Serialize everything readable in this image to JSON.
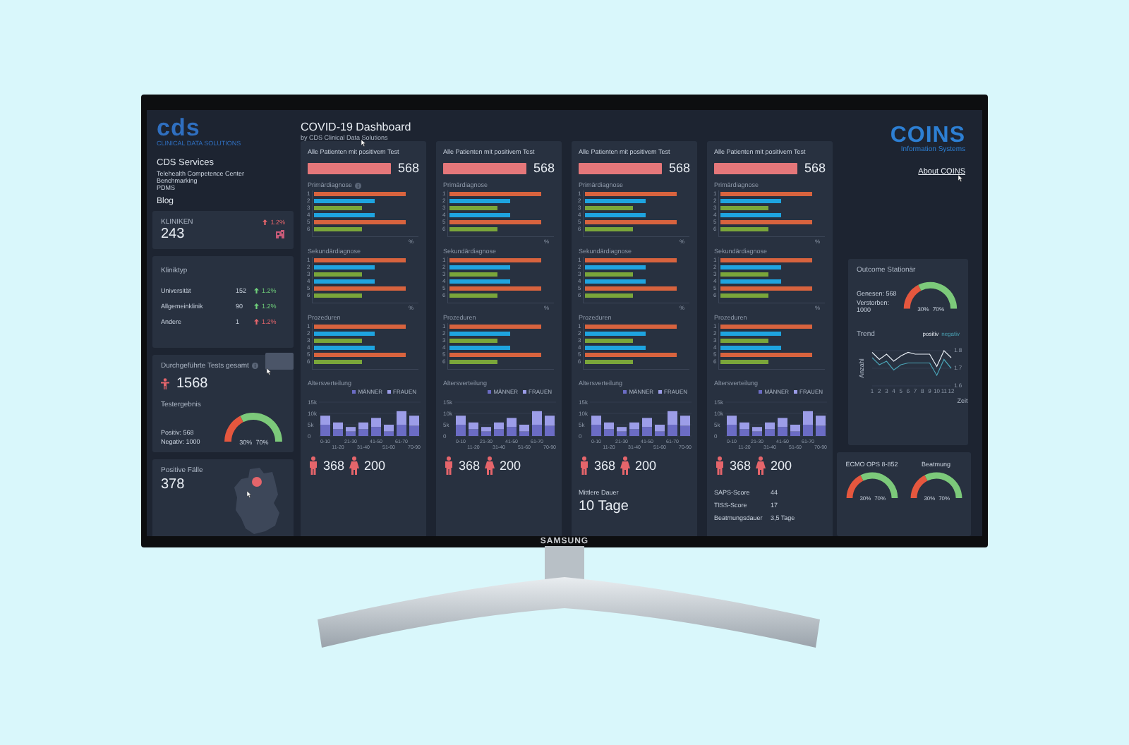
{
  "header": {
    "title": "COVID-19 Dashboard",
    "subtitle": "by CDS Clinical Data Solutions"
  },
  "brand": {
    "logo_text": "cds",
    "tagline": "CLINICAL DATA SOLUTIONS"
  },
  "nav": {
    "title": "CDS Services",
    "links": [
      "Telehealth Competence Center",
      "Benchmarking",
      "PDMS"
    ],
    "blog": "Blog"
  },
  "kliniken": {
    "label": "KLINIKEN",
    "change": "1.2%",
    "value": "243"
  },
  "kliniktyp": {
    "title": "Kliniktyp",
    "rows": [
      {
        "name": "Universität",
        "count": "152",
        "change": "1.2%",
        "color": "#6fcf7a"
      },
      {
        "name": "Allgemeinklinik",
        "count": "90",
        "change": "1.2%",
        "color": "#6fcf7a"
      },
      {
        "name": "Andere",
        "count": "1",
        "change": "1.2%",
        "color": "#e5656b"
      }
    ]
  },
  "tests": {
    "title": "Durchgeführte Tests gesamt",
    "value": "1568",
    "result_title": "Testergebnis",
    "positive": "Positiv: 568",
    "negative": "Negativ: 1000",
    "gauge": {
      "low": "30%",
      "high": "70%"
    }
  },
  "positive_cases": {
    "title": "Positive Fälle",
    "value": "378"
  },
  "panels": [
    {
      "title": "Alle Patienten mit positivem Test",
      "total": "568",
      "sections": [
        {
          "title": "Primärdiagnose",
          "info": true,
          "rows": [
            "1",
            "2",
            "3",
            "4",
            "5",
            "6"
          ],
          "unit": "%"
        },
        {
          "title": "Sekundärdiagnose",
          "info": false,
          "rows": [
            "1",
            "2",
            "3",
            "4",
            "5",
            "6"
          ],
          "unit": "%"
        },
        {
          "title": "Prozeduren",
          "info": false,
          "rows": [
            "1",
            "2",
            "3",
            "4",
            "5",
            "6"
          ]
        }
      ],
      "age": {
        "title": "Altersverteilung",
        "chart_data": {
          "type": "bar",
          "stacked": true,
          "categories": [
            "0-10",
            "11-20",
            "21-30",
            "31-40",
            "41-50",
            "51-60",
            "61-70",
            "70-90"
          ],
          "ylim": [
            0,
            15000
          ],
          "yticks": [
            {
              "value": 0,
              "label": "0"
            },
            {
              "value": 5000,
              "label": "5k"
            },
            {
              "value": 10000,
              "label": "10k"
            },
            {
              "value": 15000,
              "label": "15k"
            }
          ],
          "series": [
            {
              "name": "MÄNNER",
              "color": "#6b6cc4",
              "values": [
                5000,
                3000,
                2000,
                3000,
                4000,
                2000,
                5000,
                4500
              ]
            },
            {
              "name": "FRAUEN",
              "color": "#9c9de8",
              "values": [
                4000,
                3000,
                2000,
                3000,
                4000,
                3000,
                6000,
                4500
              ]
            }
          ]
        }
      },
      "male": "368",
      "female": "200"
    },
    {
      "title": "Alle Patienten mit positivem Test",
      "total": "568",
      "sections": [
        {
          "title": "Primärdiagnose",
          "info": false,
          "rows": [
            "1",
            "2",
            "3",
            "4",
            "5",
            "6"
          ],
          "unit": "%"
        },
        {
          "title": "Sekundärdiagnose",
          "info": false,
          "rows": [
            "1",
            "2",
            "3",
            "4",
            "5",
            "6"
          ],
          "unit": "%"
        },
        {
          "title": "Prozeduren",
          "info": false,
          "rows": [
            "1",
            "2",
            "3",
            "4",
            "5",
            "6"
          ]
        }
      ],
      "age": {
        "title": "Altersverteilung",
        "chart_data": {
          "type": "bar",
          "stacked": true,
          "categories": [
            "0-10",
            "11-20",
            "21-30",
            "31-40",
            "41-50",
            "51-60",
            "61-70",
            "70-90"
          ],
          "ylim": [
            0,
            15000
          ],
          "yticks": [
            {
              "value": 0,
              "label": "0"
            },
            {
              "value": 5000,
              "label": "5k"
            },
            {
              "value": 10000,
              "label": "10k"
            },
            {
              "value": 15000,
              "label": "15k"
            }
          ],
          "series": [
            {
              "name": "MÄNNER",
              "color": "#6b6cc4",
              "values": [
                5000,
                3000,
                2000,
                3000,
                4000,
                2000,
                5000,
                4500
              ]
            },
            {
              "name": "FRAUEN",
              "color": "#9c9de8",
              "values": [
                4000,
                3000,
                2000,
                3000,
                4000,
                3000,
                6000,
                4500
              ]
            }
          ]
        }
      },
      "male": "368",
      "female": "200"
    },
    {
      "title": "Alle Patienten mit positivem Test",
      "total": "568",
      "sections": [
        {
          "title": "Primärdiagnose",
          "info": false,
          "rows": [
            "1",
            "2",
            "3",
            "4",
            "5",
            "6"
          ],
          "unit": "%"
        },
        {
          "title": "Sekundärdiagnose",
          "info": false,
          "rows": [
            "1",
            "2",
            "3",
            "4",
            "5",
            "6"
          ],
          "unit": "%"
        },
        {
          "title": "Prozeduren",
          "info": false,
          "rows": [
            "1",
            "2",
            "3",
            "4",
            "5",
            "6"
          ]
        }
      ],
      "age": {
        "title": "Altersverteilung",
        "chart_data": {
          "type": "bar",
          "stacked": true,
          "categories": [
            "0-10",
            "11-20",
            "21-30",
            "31-40",
            "41-50",
            "51-60",
            "61-70",
            "70-90"
          ],
          "ylim": [
            0,
            15000
          ],
          "yticks": [
            {
              "value": 0,
              "label": "0"
            },
            {
              "value": 5000,
              "label": "5k"
            },
            {
              "value": 10000,
              "label": "10k"
            },
            {
              "value": 15000,
              "label": "15k"
            }
          ],
          "series": [
            {
              "name": "MÄNNER",
              "color": "#6b6cc4",
              "values": [
                5000,
                3000,
                2000,
                3000,
                4000,
                2000,
                5000,
                4500
              ]
            },
            {
              "name": "FRAUEN",
              "color": "#9c9de8",
              "values": [
                4000,
                3000,
                2000,
                3000,
                4000,
                3000,
                6000,
                4500
              ]
            }
          ]
        }
      },
      "male": "368",
      "female": "200",
      "extra": {
        "kind": "duration",
        "label": "Mittlere Dauer",
        "value": "10 Tage"
      }
    },
    {
      "title": "Alle Patienten mit positivem Test",
      "total": "568",
      "sections": [
        {
          "title": "Primärdiagnose",
          "info": false,
          "rows": [
            "1",
            "2",
            "3",
            "4",
            "5",
            "6"
          ],
          "unit": "%"
        },
        {
          "title": "Sekundärdiagnose",
          "info": false,
          "rows": [
            "1",
            "2",
            "3",
            "4",
            "5",
            "6"
          ],
          "unit": "%"
        },
        {
          "title": "Prozeduren",
          "info": false,
          "rows": [
            "1",
            "2",
            "3",
            "4",
            "5",
            "6"
          ]
        }
      ],
      "age": {
        "title": "Altersverteilung",
        "chart_data": {
          "type": "bar",
          "stacked": true,
          "categories": [
            "0-10",
            "11-20",
            "21-30",
            "31-40",
            "41-50",
            "51-60",
            "61-70",
            "70-90"
          ],
          "ylim": [
            0,
            15000
          ],
          "yticks": [
            {
              "value": 0,
              "label": "0"
            },
            {
              "value": 5000,
              "label": "5k"
            },
            {
              "value": 10000,
              "label": "10k"
            },
            {
              "value": 15000,
              "label": "15k"
            }
          ],
          "series": [
            {
              "name": "MÄNNER",
              "color": "#6b6cc4",
              "values": [
                5000,
                3000,
                2000,
                3000,
                4000,
                2000,
                5000,
                4500
              ]
            },
            {
              "name": "FRAUEN",
              "color": "#9c9de8",
              "values": [
                4000,
                3000,
                2000,
                3000,
                4000,
                3000,
                6000,
                4500
              ]
            }
          ]
        }
      },
      "male": "368",
      "female": "200",
      "extra": {
        "kind": "scores",
        "rows": [
          {
            "label": "SAPS-Score",
            "value": "44"
          },
          {
            "label": "TISS-Score",
            "value": "17"
          },
          {
            "label": "Beatmungsdauer",
            "value": "3,5 Tage"
          }
        ]
      }
    }
  ],
  "coins": {
    "logo_text": "COINS",
    "tagline": "Information Systems",
    "link": "About COINS"
  },
  "outcome": {
    "title": "Outcome Stationär",
    "recovered": "Genesen: 568",
    "deceased": "Verstorben: 1000",
    "gauge": {
      "low": "30%",
      "high": "70%"
    },
    "trend": {
      "title": "Trend",
      "chart_data": {
        "type": "line",
        "grid": true,
        "xlabel": "Zeit",
        "ylabel": "Anzahl",
        "x": [
          1,
          2,
          3,
          4,
          5,
          6,
          7,
          8,
          9,
          10,
          11,
          12
        ],
        "xlim": [
          1,
          12
        ],
        "xticks": [
          1,
          2,
          3,
          4,
          5,
          6,
          7,
          8,
          9,
          10,
          11,
          12
        ],
        "ylim": [
          1.6,
          1.8
        ],
        "yticks": [
          1.6,
          1.7,
          1.8
        ],
        "series": [
          {
            "name": "positiv",
            "color": "#e8eef5",
            "values": [
              1.79,
              1.75,
              1.78,
              1.74,
              1.77,
              1.79,
              1.78,
              1.78,
              1.78,
              1.71,
              1.8,
              1.76
            ]
          },
          {
            "name": "negativ",
            "color": "#4aa3b5",
            "values": [
              1.76,
              1.72,
              1.74,
              1.69,
              1.72,
              1.73,
              1.73,
              1.73,
              1.73,
              1.66,
              1.75,
              1.7
            ]
          }
        ]
      }
    }
  },
  "ventilation": {
    "gauges": [
      {
        "title": "ECMO OPS 8-852",
        "low": "30%",
        "high": "70%"
      },
      {
        "title": "Beatmung",
        "low": "30%",
        "high": "70%"
      }
    ]
  },
  "tv": {
    "brand": "SAMSUNG"
  }
}
